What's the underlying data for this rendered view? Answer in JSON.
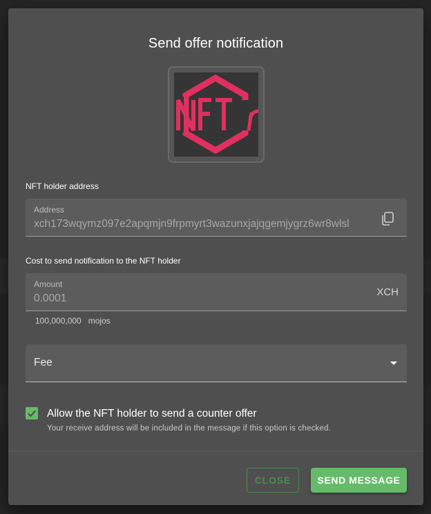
{
  "dialog": {
    "title": "Send offer notification",
    "nft_image_alt": "NFT"
  },
  "address_section": {
    "label": "NFT holder address",
    "field_label": "Address",
    "value": "xch173wqymz097e2apqmjn9frpmyrt3wazunxjajqgemjygrz6wr8wlsl"
  },
  "cost_section": {
    "label": "Cost to send notification to the NFT holder",
    "field_label": "Amount",
    "value": "0.0001",
    "suffix": "XCH",
    "helper_amount": "100,000,000",
    "helper_unit": "mojos"
  },
  "fee": {
    "placeholder": "Fee"
  },
  "counter_offer": {
    "checked": true,
    "label": "Allow the NFT holder to send a counter offer",
    "helper": "Your receive address will be included in the message if this option is checked."
  },
  "actions": {
    "close_label": "CLOSE",
    "send_label": "SEND MESSAGE"
  },
  "colors": {
    "accent": "#66bb6a",
    "nft_logo": "#e0305f"
  }
}
